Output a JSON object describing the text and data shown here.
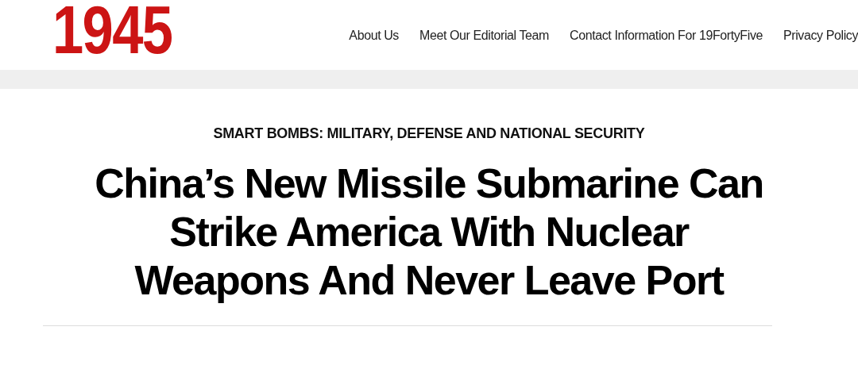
{
  "header": {
    "logo": "1945",
    "nav": [
      {
        "label": "About Us"
      },
      {
        "label": "Meet Our Editorial Team"
      },
      {
        "label": "Contact Information For 19FortyFive"
      },
      {
        "label": "Privacy Policy"
      }
    ]
  },
  "article": {
    "category": "SMART BOMBS: MILITARY, DEFENSE AND NATIONAL SECURITY",
    "headline": "China’s New Missile Submarine Can Strike America With Nuclear Weapons And Never Leave Port"
  }
}
